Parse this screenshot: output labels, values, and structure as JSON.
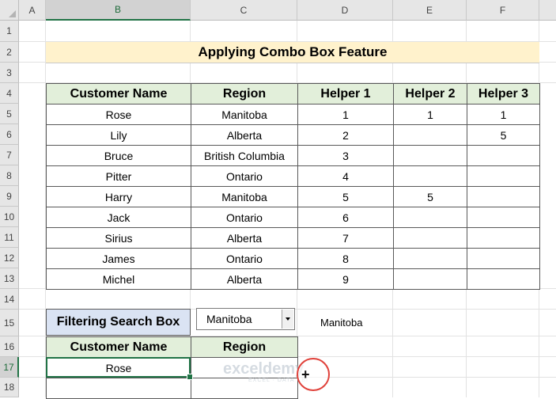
{
  "columns": [
    "A",
    "B",
    "C",
    "D",
    "E",
    "F"
  ],
  "rows": [
    "1",
    "2",
    "3",
    "4",
    "5",
    "6",
    "7",
    "8",
    "9",
    "10",
    "11",
    "12",
    "13",
    "14",
    "15",
    "16",
    "17",
    "18"
  ],
  "title": "Applying Combo Box Feature",
  "main_table": {
    "headers": [
      "Customer Name",
      "Region",
      "Helper 1",
      "Helper 2",
      "Helper 3"
    ],
    "rows": [
      [
        "Rose",
        "Manitoba",
        "1",
        "1",
        "1"
      ],
      [
        "Lily",
        "Alberta",
        "2",
        "",
        "5"
      ],
      [
        "Bruce",
        "British Columbia",
        "3",
        "",
        ""
      ],
      [
        "Pitter",
        "Ontario",
        "4",
        "",
        ""
      ],
      [
        "Harry",
        "Manitoba",
        "5",
        "5",
        ""
      ],
      [
        "Jack",
        "Ontario",
        "6",
        "",
        ""
      ],
      [
        "Sirius",
        "Alberta",
        "7",
        "",
        ""
      ],
      [
        "James",
        "Ontario",
        "8",
        "",
        ""
      ],
      [
        "Michel",
        "Alberta",
        "9",
        "",
        ""
      ]
    ]
  },
  "filter": {
    "label": "Filtering Search Box",
    "combo_value": "Manitoba",
    "linked_cell": "Manitoba",
    "headers": [
      "Customer Name",
      "Region"
    ],
    "rows": [
      [
        "Rose",
        ""
      ],
      [
        "",
        ""
      ]
    ]
  },
  "watermark": {
    "name": "exceldemy",
    "tagline": "EXCEL · DATA · BI"
  }
}
